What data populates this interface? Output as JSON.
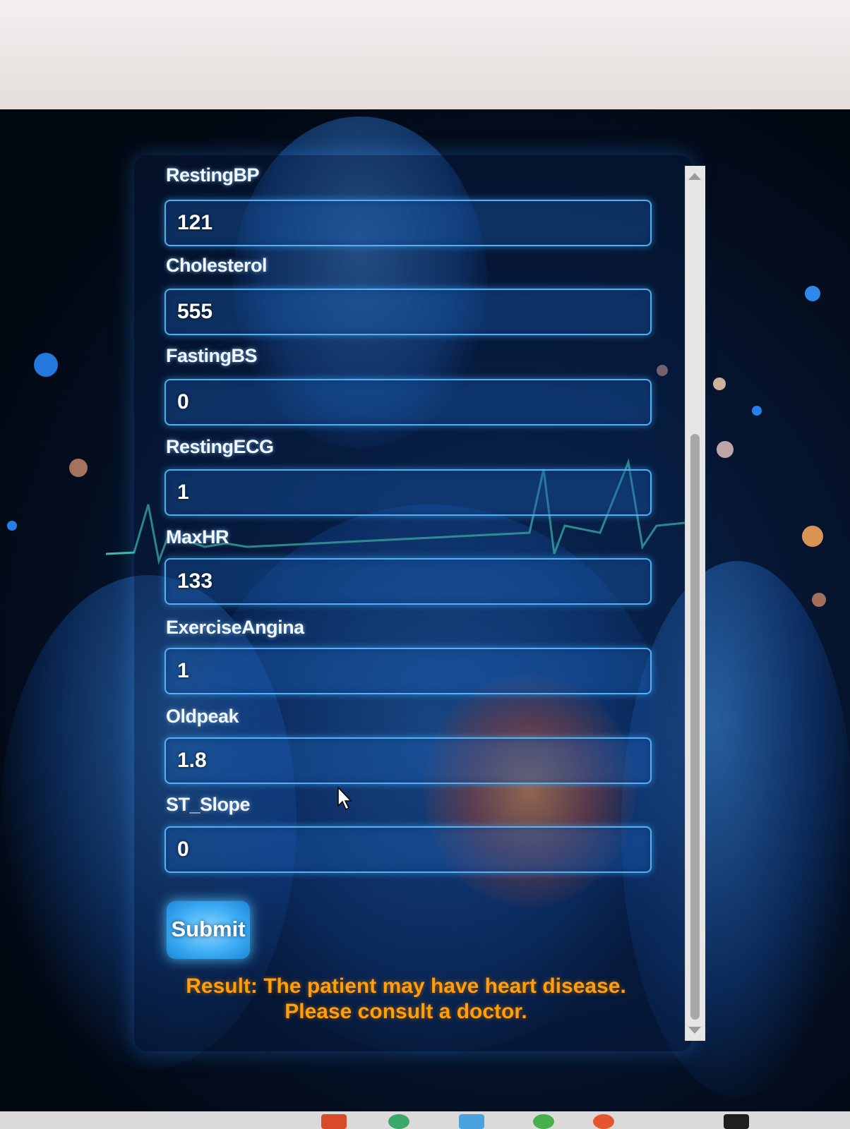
{
  "form": {
    "fields": [
      {
        "label": "RestingBP",
        "value": "121"
      },
      {
        "label": "Cholesterol",
        "value": "555"
      },
      {
        "label": "FastingBS",
        "value": "0"
      },
      {
        "label": "RestingECG",
        "value": "1"
      },
      {
        "label": "MaxHR",
        "value": "133"
      },
      {
        "label": "ExerciseAngina",
        "value": "1"
      },
      {
        "label": "Oldpeak",
        "value": "1.8"
      },
      {
        "label": "ST_Slope",
        "value": "0"
      }
    ],
    "submit_label": "Submit"
  },
  "result": {
    "line1": "Result: The patient may have heart disease.",
    "line2": "Please consult a doctor."
  },
  "colors": {
    "accent": "#3eaef5",
    "result": "#ff9f0e",
    "background": "#061632"
  }
}
